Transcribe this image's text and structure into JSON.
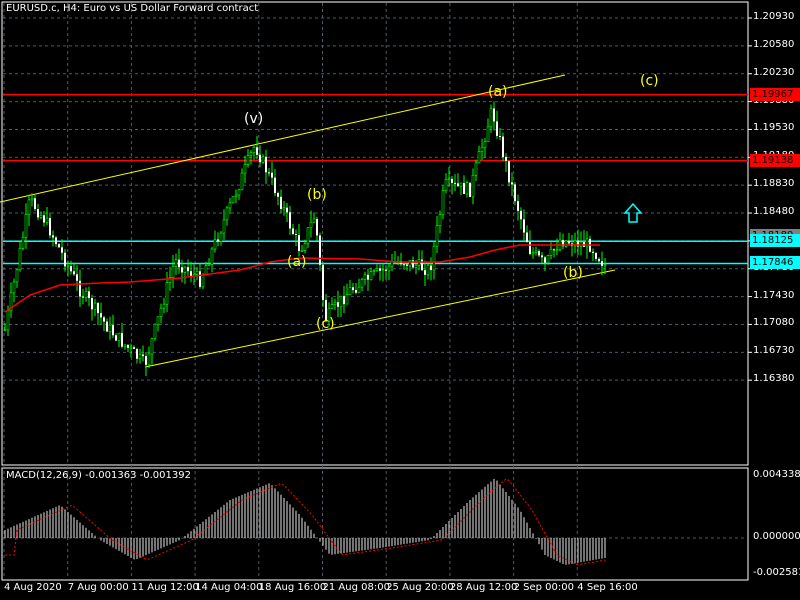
{
  "title": "EURUSD.c, H4:  Euro vs US Dollar Forward contract",
  "macd_label": "MACD(12,26,9) -0.001363 -0.001392",
  "price_axis": [
    "1.20930",
    "1.20580",
    "1.20230",
    "1.19880",
    "1.19530",
    "1.19180",
    "1.18830",
    "1.18480",
    "1.18130",
    "1.17780",
    "1.17430",
    "1.17080",
    "1.16730",
    "1.16380"
  ],
  "macd_axis": [
    "0.004338",
    "0.000000",
    "-0.002581"
  ],
  "time_axis": [
    "4 Aug 2020",
    "7 Aug 00:00",
    "11 Aug 12:00",
    "14 Aug 04:00",
    "18 Aug 16:00",
    "21 Aug 08:00",
    "25 Aug 20:00",
    "28 Aug 12:00",
    "2 Sep 00:00",
    "4 Sep 16:00"
  ],
  "levels": [
    {
      "price": "1.19967",
      "color": "#ff0000"
    },
    {
      "price": "1.19138",
      "color": "#ff0000"
    },
    {
      "price": "1.18189",
      "color": "#808080"
    },
    {
      "price": "1.18125",
      "color": "#00ffff"
    },
    {
      "price": "1.17846",
      "color": "#00ffff"
    }
  ],
  "wave_labels": [
    "(v)",
    "(a)",
    "(c)",
    "(b)",
    "(a)",
    "(c)",
    "(b)"
  ],
  "colors": {
    "candle": "#00ff00",
    "ma": "#ff0000",
    "channel": "#ffff00",
    "grid": "#4a5a6a",
    "macd_hist": "#c0c0c0",
    "macd_signal": "#ff0000"
  }
}
